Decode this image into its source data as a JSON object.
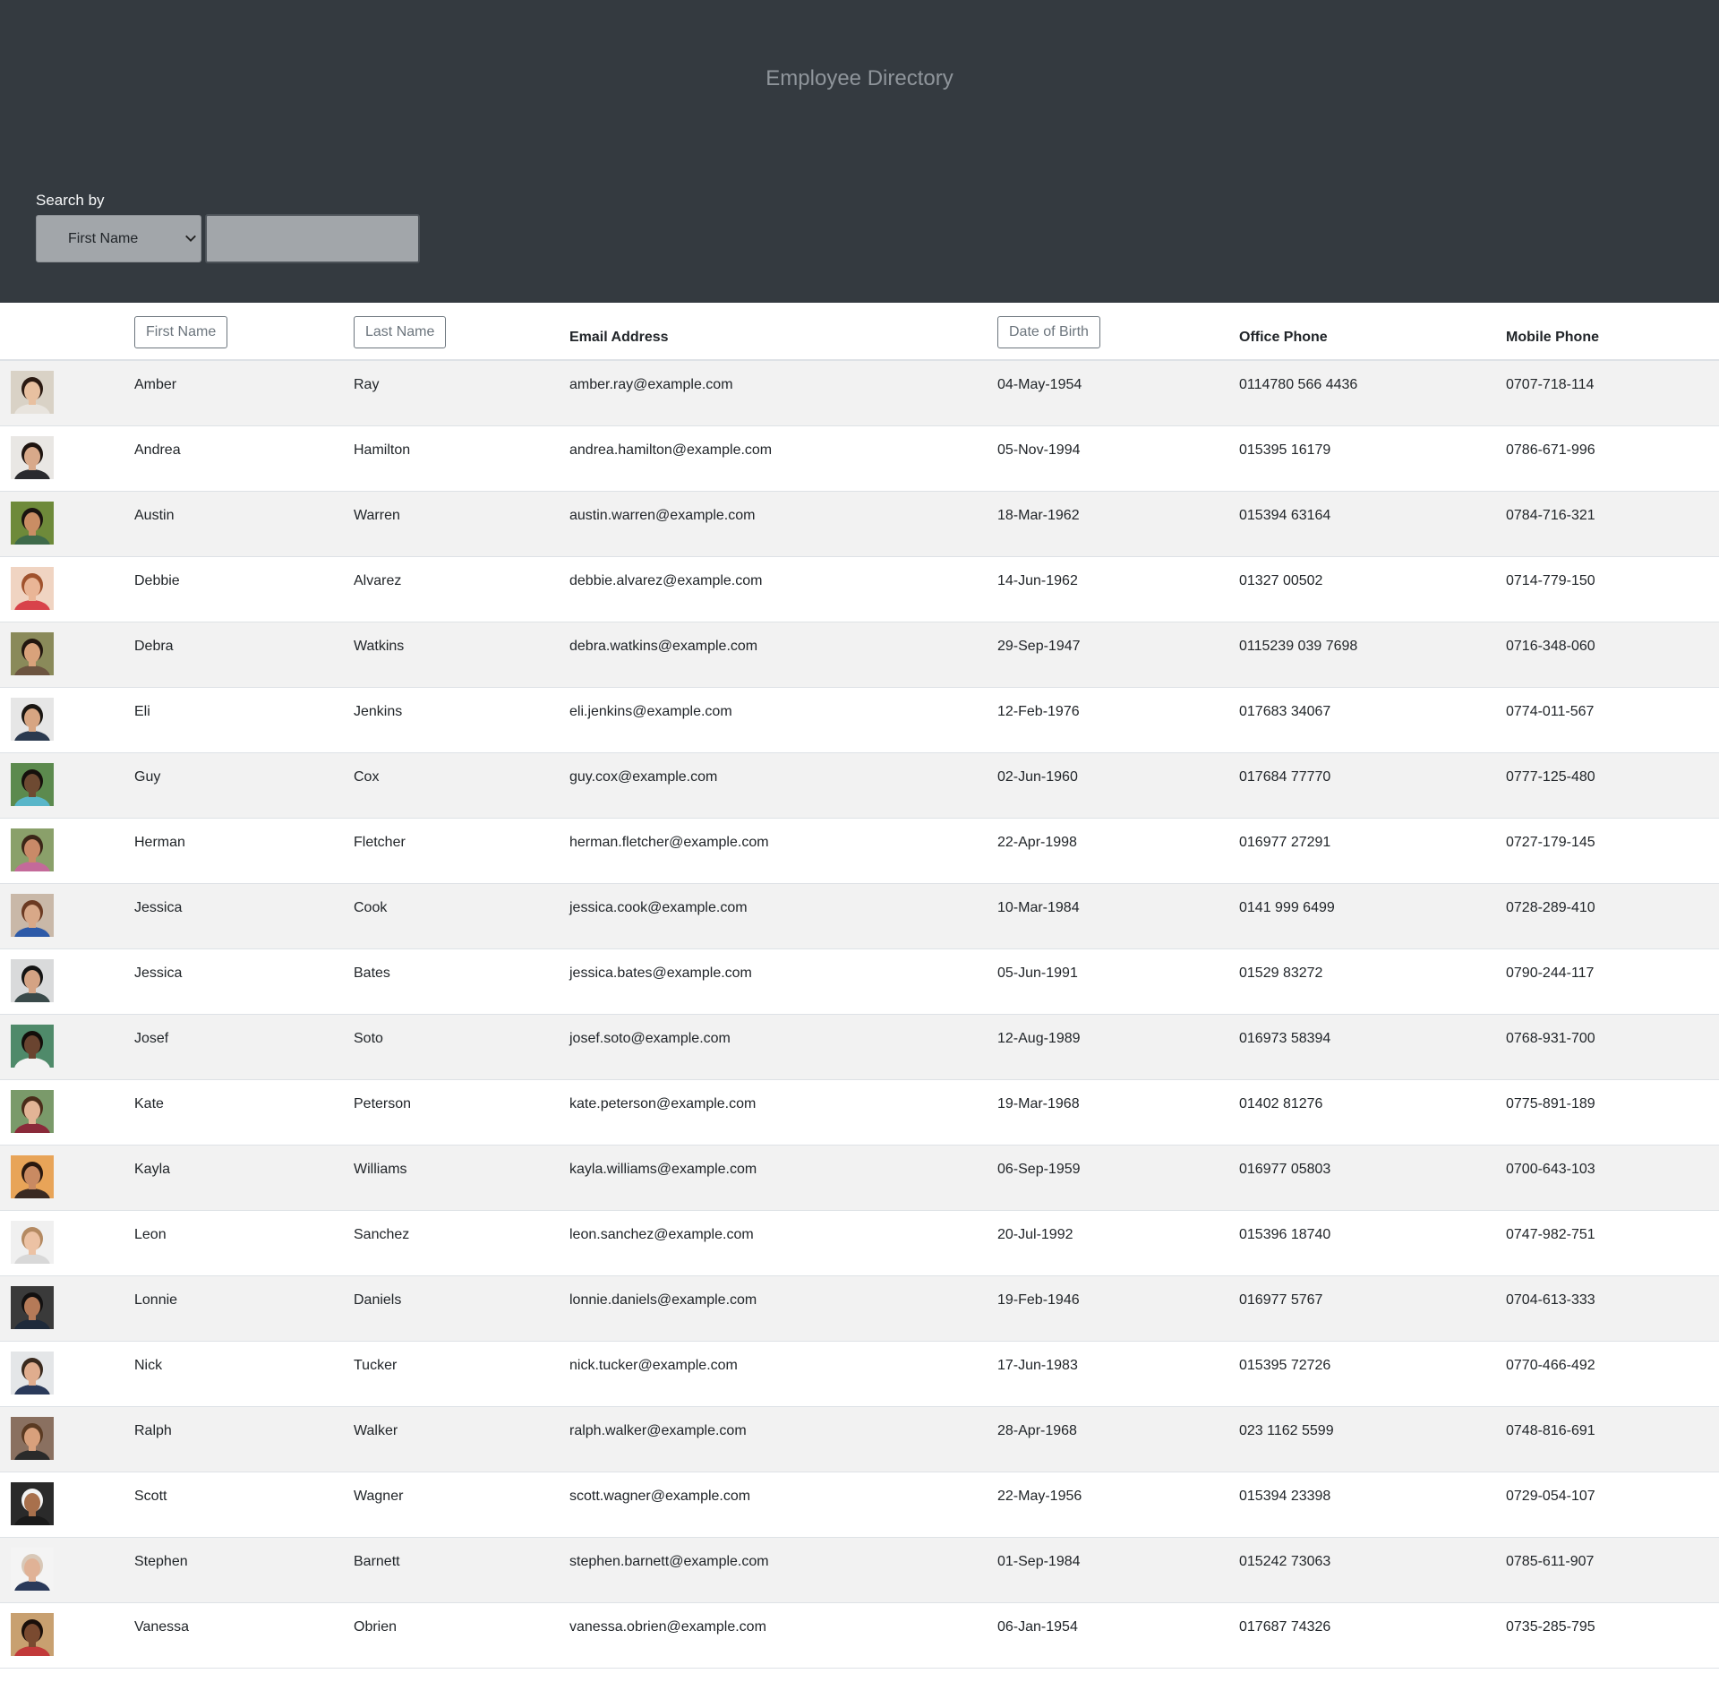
{
  "header": {
    "title": "Employee Directory",
    "search_label": "Search by",
    "search_select_value": "First Name",
    "search_input_value": ""
  },
  "columns": {
    "first_name": "First Name",
    "last_name": "Last Name",
    "email": "Email Address",
    "dob": "Date of Birth",
    "office": "Office Phone",
    "mobile": "Mobile Phone"
  },
  "employees": [
    {
      "first": "Amber",
      "last": "Ray",
      "email": "amber.ray@example.com",
      "dob": "04-May-1954",
      "office": "0114780 566 4436",
      "mobile": "0707-718-114",
      "skin": "#e8c0a0",
      "hair": "#2b1a12",
      "bg": "#d9d2c6",
      "shirt": "#e8e4de"
    },
    {
      "first": "Andrea",
      "last": "Hamilton",
      "email": "andrea.hamilton@example.com",
      "dob": "05-Nov-1994",
      "office": "015395 16179",
      "mobile": "0786-671-996",
      "skin": "#d8a98a",
      "hair": "#1e1410",
      "bg": "#e9e7e4",
      "shirt": "#2a2a2e"
    },
    {
      "first": "Austin",
      "last": "Warren",
      "email": "austin.warren@example.com",
      "dob": "18-Mar-1962",
      "office": "015394 63164",
      "mobile": "0784-716-321",
      "skin": "#c98d64",
      "hair": "#1a1410",
      "bg": "#6e8a3a",
      "shirt": "#3e6a4a"
    },
    {
      "first": "Debbie",
      "last": "Alvarez",
      "email": "debbie.alvarez@example.com",
      "dob": "14-Jun-1962",
      "office": "01327 00502",
      "mobile": "0714-779-150",
      "skin": "#e9b596",
      "hair": "#a0522d",
      "bg": "#f0d4c2",
      "shirt": "#d8434a"
    },
    {
      "first": "Debra",
      "last": "Watkins",
      "email": "debra.watkins@example.com",
      "dob": "29-Sep-1947",
      "office": "0115239 039 7698",
      "mobile": "0716-348-060",
      "skin": "#d9a27b",
      "hair": "#22160f",
      "bg": "#8a8a5a",
      "shirt": "#6c5440"
    },
    {
      "first": "Eli",
      "last": "Jenkins",
      "email": "eli.jenkins@example.com",
      "dob": "12-Feb-1976",
      "office": "017683 34067",
      "mobile": "0774-011-567",
      "skin": "#d7a582",
      "hair": "#1a1612",
      "bg": "#e6e6e6",
      "shirt": "#2b3a4f"
    },
    {
      "first": "Guy",
      "last": "Cox",
      "email": "guy.cox@example.com",
      "dob": "02-Jun-1960",
      "office": "017684 77770",
      "mobile": "0777-125-480",
      "skin": "#6e4a32",
      "hair": "#15100c",
      "bg": "#5c8a4e",
      "shirt": "#59b6c9"
    },
    {
      "first": "Herman",
      "last": "Fletcher",
      "email": "herman.fletcher@example.com",
      "dob": "22-Apr-1998",
      "office": "016977 27291",
      "mobile": "0727-179-145",
      "skin": "#c98a68",
      "hair": "#3b2618",
      "bg": "#8aa06a",
      "shirt": "#c46a9a"
    },
    {
      "first": "Jessica",
      "last": "Cook",
      "email": "jessica.cook@example.com",
      "dob": "10-Mar-1984",
      "office": "0141 999 6499",
      "mobile": "0728-289-410",
      "skin": "#d8a888",
      "hair": "#6b3a22",
      "bg": "#c9b8a8",
      "shirt": "#2d5aa8"
    },
    {
      "first": "Jessica",
      "last": "Bates",
      "email": "jessica.bates@example.com",
      "dob": "05-Jun-1991",
      "office": "01529 83272",
      "mobile": "0790-244-117",
      "skin": "#d4a384",
      "hair": "#141414",
      "bg": "#d9dadb",
      "shirt": "#3a4a4a"
    },
    {
      "first": "Josef",
      "last": "Soto",
      "email": "josef.soto@example.com",
      "dob": "12-Aug-1989",
      "office": "016973 58394",
      "mobile": "0768-931-700",
      "skin": "#6a4430",
      "hair": "#120d0a",
      "bg": "#4f8a6a",
      "shirt": "#f2f2f2"
    },
    {
      "first": "Kate",
      "last": "Peterson",
      "email": "kate.peterson@example.com",
      "dob": "19-Mar-1968",
      "office": "01402 81276",
      "mobile": "0775-891-189",
      "skin": "#e2b496",
      "hair": "#4a2c1a",
      "bg": "#7a9a6a",
      "shirt": "#8a2a3a"
    },
    {
      "first": "Kayla",
      "last": "Williams",
      "email": "kayla.williams@example.com",
      "dob": "06-Sep-1959",
      "office": "016977 05803",
      "mobile": "0700-643-103",
      "skin": "#c98a62",
      "hair": "#2a180e",
      "bg": "#e8a458",
      "shirt": "#3a2a22"
    },
    {
      "first": "Leon",
      "last": "Sanchez",
      "email": "leon.sanchez@example.com",
      "dob": "20-Jul-1992",
      "office": "015396 18740",
      "mobile": "0747-982-751",
      "skin": "#ecc2a4",
      "hair": "#b48a62",
      "bg": "#f0f0f0",
      "shirt": "#d8d8d8"
    },
    {
      "first": "Lonnie",
      "last": "Daniels",
      "email": "lonnie.daniels@example.com",
      "dob": "19-Feb-1946",
      "office": "016977 5767",
      "mobile": "0704-613-333",
      "skin": "#b57a58",
      "hair": "#121010",
      "bg": "#3a3a3a",
      "shirt": "#1e2a3a"
    },
    {
      "first": "Nick",
      "last": "Tucker",
      "email": "nick.tucker@example.com",
      "dob": "17-Jun-1983",
      "office": "015395 72726",
      "mobile": "0770-466-492",
      "skin": "#e0ad8e",
      "hair": "#3a2a1e",
      "bg": "#e4e6e8",
      "shirt": "#2a3a5a"
    },
    {
      "first": "Ralph",
      "last": "Walker",
      "email": "ralph.walker@example.com",
      "dob": "28-Apr-1968",
      "office": "023 1162 5599",
      "mobile": "0748-816-691",
      "skin": "#d8a07c",
      "hair": "#5a3a22",
      "bg": "#8a7060",
      "shirt": "#2a2a2a"
    },
    {
      "first": "Scott",
      "last": "Wagner",
      "email": "scott.wagner@example.com",
      "dob": "22-May-1956",
      "office": "015394 23398",
      "mobile": "0729-054-107",
      "skin": "#a8704c",
      "hair": "#f2f2f2",
      "bg": "#2a2a2a",
      "shirt": "#1a1a1a"
    },
    {
      "first": "Stephen",
      "last": "Barnett",
      "email": "stephen.barnett@example.com",
      "dob": "01-Sep-1984",
      "office": "015242 73063",
      "mobile": "0785-611-907",
      "skin": "#e0b296",
      "hair": "#d8c8b8",
      "bg": "#f4f4f4",
      "shirt": "#2a3a5a"
    },
    {
      "first": "Vanessa",
      "last": "Obrien",
      "email": "vanessa.obrien@example.com",
      "dob": "06-Jan-1954",
      "office": "017687 74326",
      "mobile": "0735-285-795",
      "skin": "#7a4a30",
      "hair": "#1a0f0a",
      "bg": "#c8a070",
      "shirt": "#c23a3a"
    }
  ]
}
